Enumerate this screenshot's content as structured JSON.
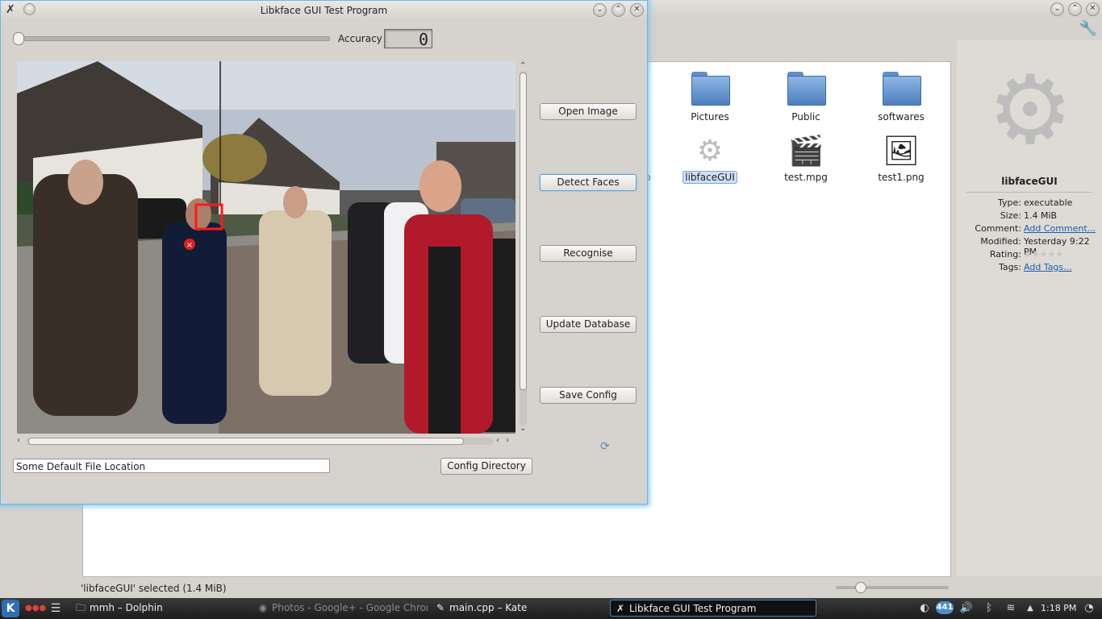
{
  "dolphin": {
    "files": [
      {
        "name": "Pictures",
        "type": "folder"
      },
      {
        "name": "Public",
        "type": "folder"
      },
      {
        "name": "softwares",
        "type": "folder"
      },
      {
        "name": "libfaceGUI",
        "type": "executable"
      },
      {
        "name": "test.mpg",
        "type": "video"
      },
      {
        "name": "test1.png",
        "type": "image"
      }
    ],
    "cut_label": "p",
    "info": {
      "title": "libfaceGUI",
      "type_key": "Type:",
      "type_val": "executable",
      "size_key": "Size:",
      "size_val": "1.4 MiB",
      "comment_key": "Comment:",
      "comment_val": "Add Comment...",
      "modified_key": "Modified:",
      "modified_val": "Yesterday 9:22 PM",
      "rating_key": "Rating:",
      "rating_stars": "★★★★★",
      "tags_key": "Tags:",
      "tags_val": "Add Tags..."
    },
    "status": "'libfaceGUI' selected (1.4 MiB)"
  },
  "libkface": {
    "title": "Libkface GUI Test Program",
    "accuracy_label": "Accuracy",
    "accuracy_value": "0",
    "accuracy_slider": 0,
    "buttons": {
      "open": "Open Image",
      "detect": "Detect Faces",
      "recognise": "Recognise",
      "update": "Update Database",
      "save": "Save Config",
      "config_dir": "Config Directory"
    },
    "path_value": "Some Default File Location"
  },
  "taskbar": {
    "tasks": [
      {
        "label": "mmh – Dolphin",
        "icon": "folder-icon"
      },
      {
        "label": "Photos - Google+ - Google Chrome",
        "icon": "chrome-icon"
      },
      {
        "label": "main.cpp – Kate",
        "icon": "text-editor-icon"
      },
      {
        "label": "Libkface GUI Test Program",
        "icon": "app-icon"
      }
    ],
    "badge": "441",
    "clock": "1:18 PM"
  }
}
